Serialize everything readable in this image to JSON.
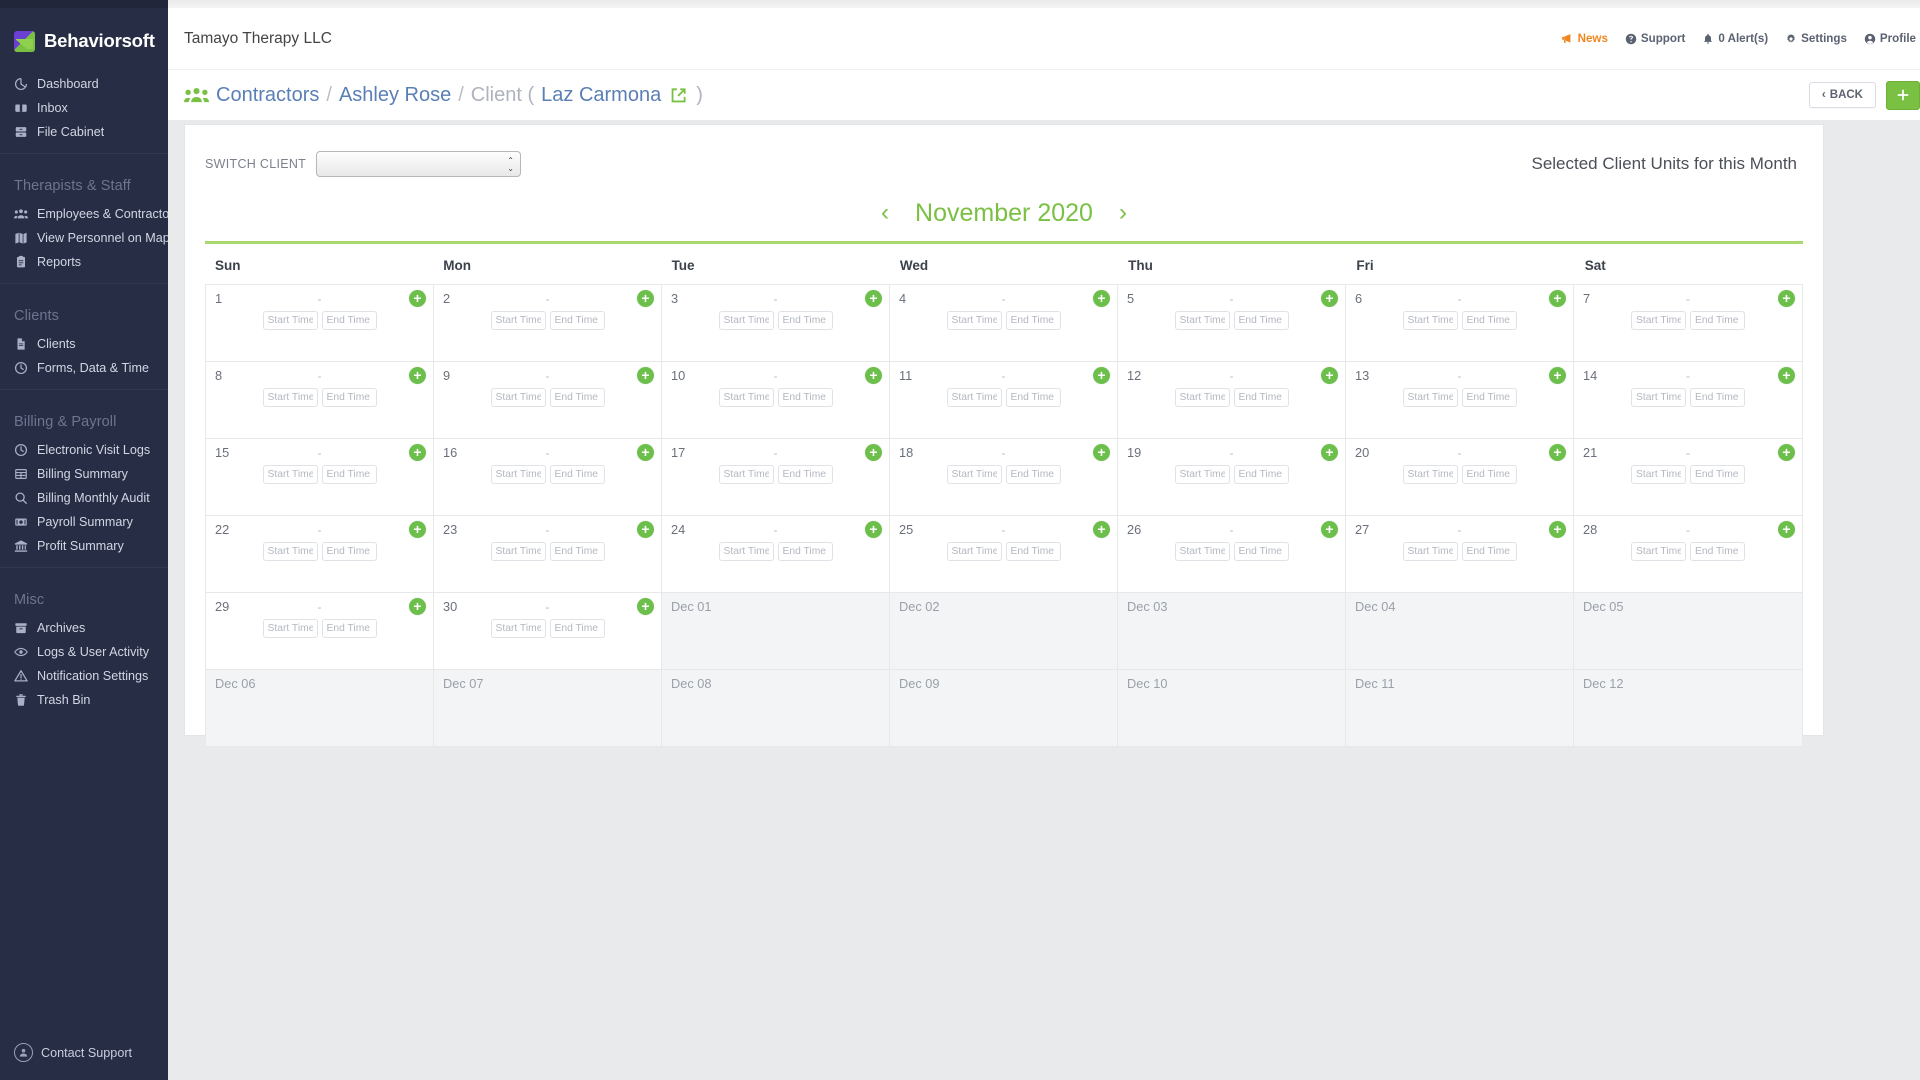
{
  "sidebar": {
    "brand": "Behaviorsoft",
    "groups": [
      {
        "title": null,
        "items": [
          {
            "label": "Dashboard",
            "icon": "pie-chart-icon"
          },
          {
            "label": "Inbox",
            "icon": "inbox-icon"
          },
          {
            "label": "File Cabinet",
            "icon": "file-cabinet-icon"
          }
        ]
      },
      {
        "title": "Therapists & Staff",
        "items": [
          {
            "label": "Employees & Contractors",
            "icon": "people-icon"
          },
          {
            "label": "View Personnel on Map",
            "icon": "map-icon"
          },
          {
            "label": "Reports",
            "icon": "clipboard-icon"
          }
        ]
      },
      {
        "title": "Clients",
        "items": [
          {
            "label": "Clients",
            "icon": "document-icon"
          },
          {
            "label": "Forms, Data & Time",
            "icon": "clock-icon"
          }
        ]
      },
      {
        "title": "Billing & Payroll",
        "items": [
          {
            "label": "Electronic Visit Logs",
            "icon": "clock-icon"
          },
          {
            "label": "Billing Summary",
            "icon": "table-icon"
          },
          {
            "label": "Billing Monthly Audit",
            "icon": "search-icon"
          },
          {
            "label": "Payroll Summary",
            "icon": "money-icon"
          },
          {
            "label": "Profit Summary",
            "icon": "bank-icon"
          }
        ]
      },
      {
        "title": "Misc",
        "items": [
          {
            "label": "Archives",
            "icon": "archive-icon"
          },
          {
            "label": "Logs & User Activity",
            "icon": "eye-icon"
          },
          {
            "label": "Notification Settings",
            "icon": "warning-icon"
          },
          {
            "label": "Trash Bin",
            "icon": "trash-icon"
          }
        ]
      }
    ],
    "contact_support": "Contact Support"
  },
  "header": {
    "org_title": "Tamayo Therapy LLC",
    "nav": [
      {
        "label": "News",
        "icon": "megaphone-icon",
        "accent": "#f0861f"
      },
      {
        "label": "Support",
        "icon": "question-circle-icon"
      },
      {
        "label": "0 Alert(s)",
        "icon": "bell-icon"
      },
      {
        "label": "Settings",
        "icon": "gear-icon"
      },
      {
        "label": "Profile",
        "icon": "user-circle-icon"
      }
    ]
  },
  "breadcrumb": {
    "root": "Contractors",
    "sep": "/",
    "person": "Ashley Rose",
    "client_prefix": "Client (",
    "client_name": "Laz Carmona",
    "client_suffix": ")",
    "back_button": "BACK",
    "back_chevron": "‹"
  },
  "calendar_panel": {
    "switch_client_label": "SWITCH CLIENT",
    "switch_client_value": "",
    "units_text": "Selected Client Units for this Month",
    "prev_arrow": "‹",
    "next_arrow": "›",
    "month_label": "November 2020",
    "day_headers": [
      "Sun",
      "Mon",
      "Tue",
      "Wed",
      "Thu",
      "Fri",
      "Sat"
    ],
    "start_time_placeholder": "Start Time",
    "end_time_placeholder": "End Time",
    "dash": "-",
    "add_symbol": "+",
    "accent_green": "#7ac143",
    "weeks": [
      [
        {
          "label": "1",
          "muted": false
        },
        {
          "label": "2",
          "muted": false
        },
        {
          "label": "3",
          "muted": false
        },
        {
          "label": "4",
          "muted": false
        },
        {
          "label": "5",
          "muted": false
        },
        {
          "label": "6",
          "muted": false
        },
        {
          "label": "7",
          "muted": false
        }
      ],
      [
        {
          "label": "8",
          "muted": false
        },
        {
          "label": "9",
          "muted": false
        },
        {
          "label": "10",
          "muted": false
        },
        {
          "label": "11",
          "muted": false
        },
        {
          "label": "12",
          "muted": false
        },
        {
          "label": "13",
          "muted": false
        },
        {
          "label": "14",
          "muted": false
        }
      ],
      [
        {
          "label": "15",
          "muted": false
        },
        {
          "label": "16",
          "muted": false
        },
        {
          "label": "17",
          "muted": false
        },
        {
          "label": "18",
          "muted": false
        },
        {
          "label": "19",
          "muted": false
        },
        {
          "label": "20",
          "muted": false
        },
        {
          "label": "21",
          "muted": false
        }
      ],
      [
        {
          "label": "22",
          "muted": false
        },
        {
          "label": "23",
          "muted": false
        },
        {
          "label": "24",
          "muted": false
        },
        {
          "label": "25",
          "muted": false
        },
        {
          "label": "26",
          "muted": false
        },
        {
          "label": "27",
          "muted": false
        },
        {
          "label": "28",
          "muted": false
        }
      ],
      [
        {
          "label": "29",
          "muted": false
        },
        {
          "label": "30",
          "muted": false
        },
        {
          "label": "Dec 01",
          "muted": true
        },
        {
          "label": "Dec 02",
          "muted": true
        },
        {
          "label": "Dec 03",
          "muted": true
        },
        {
          "label": "Dec 04",
          "muted": true
        },
        {
          "label": "Dec 05",
          "muted": true
        }
      ],
      [
        {
          "label": "Dec 06",
          "muted": true
        },
        {
          "label": "Dec 07",
          "muted": true
        },
        {
          "label": "Dec 08",
          "muted": true
        },
        {
          "label": "Dec 09",
          "muted": true
        },
        {
          "label": "Dec 10",
          "muted": true
        },
        {
          "label": "Dec 11",
          "muted": true
        },
        {
          "label": "Dec 12",
          "muted": true
        }
      ]
    ]
  }
}
